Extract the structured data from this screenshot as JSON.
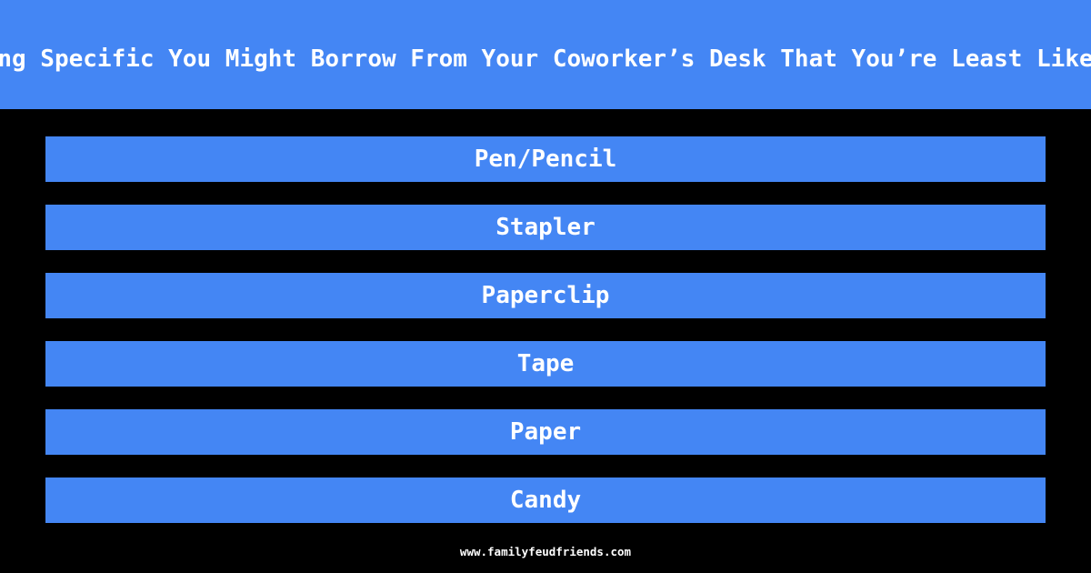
{
  "header": {
    "title": "Name Something Specific You Might Borrow From Your Coworker’s Desk That You’re Least Likely To Return"
  },
  "answers": [
    {
      "label": "Pen/Pencil"
    },
    {
      "label": "Stapler"
    },
    {
      "label": "Paperclip"
    },
    {
      "label": "Tape"
    },
    {
      "label": "Paper"
    },
    {
      "label": "Candy"
    }
  ],
  "footer": {
    "site": "www.familyfeudfriends.com"
  },
  "colors": {
    "accent": "#4486f4",
    "background": "#000000",
    "text": "#ffffff"
  }
}
